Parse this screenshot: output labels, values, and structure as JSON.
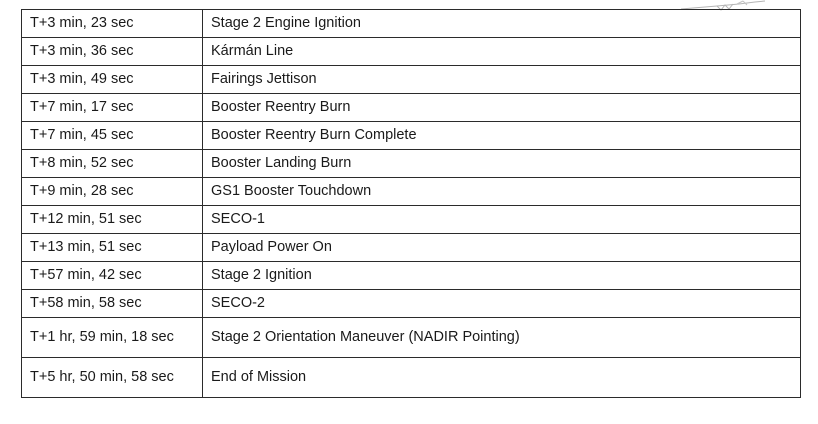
{
  "colors": {
    "border": "#2b2b2b",
    "text": "#1a1a1a",
    "background": "#ffffff"
  },
  "decoration": {
    "icon": "rocket-sketch-icon"
  },
  "rows": [
    {
      "time": "T+3 min, 23 sec",
      "event": "Stage 2 Engine Ignition"
    },
    {
      "time": "T+3 min, 36 sec",
      "event": "Kármán Line"
    },
    {
      "time": "T+3 min, 49 sec",
      "event": "Fairings Jettison"
    },
    {
      "time": "T+7 min, 17 sec",
      "event": "Booster Reentry Burn"
    },
    {
      "time": "T+7 min, 45 sec",
      "event": "Booster Reentry Burn Complete"
    },
    {
      "time": "T+8 min, 52 sec",
      "event": "Booster Landing Burn"
    },
    {
      "time": "T+9 min, 28 sec",
      "event": "GS1 Booster Touchdown"
    },
    {
      "time": "T+12 min, 51 sec",
      "event": "SECO-1"
    },
    {
      "time": "T+13 min, 51 sec",
      "event": "Payload Power On"
    },
    {
      "time": "T+57 min, 42 sec",
      "event": "Stage 2 Ignition"
    },
    {
      "time": "T+58 min, 58 sec",
      "event": "SECO-2"
    },
    {
      "time": "T+1 hr, 59 min, 18 sec",
      "event": "Stage 2 Orientation Maneuver (NADIR Pointing)"
    },
    {
      "time": "T+5 hr, 50 min, 58 sec",
      "event": "End of Mission"
    }
  ]
}
